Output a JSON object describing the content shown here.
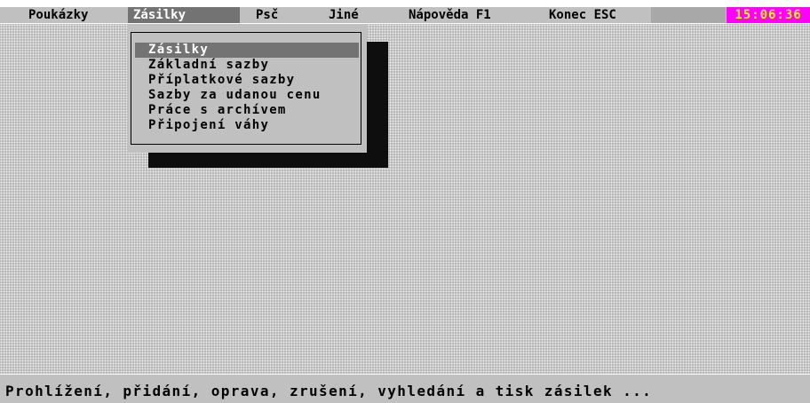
{
  "menubar": {
    "items": [
      {
        "label": "Poukázky"
      },
      {
        "label": "Zásilky"
      },
      {
        "label": "Psč"
      },
      {
        "label": "Jiné"
      },
      {
        "label": "Nápověda F1"
      },
      {
        "label": "Konec ESC"
      }
    ],
    "active_item": "Zásilky",
    "clock": "15:06:36"
  },
  "dropdown": {
    "selected_item": "Zásilky",
    "items": [
      {
        "label": "Zásilky"
      },
      {
        "label": "Základní sazby"
      },
      {
        "label": "Příplatkové sazby"
      },
      {
        "label": "Sazby za udanou cenu"
      },
      {
        "label": "Práce s archívem"
      },
      {
        "label": "Připojení váhy"
      }
    ]
  },
  "status": {
    "text": "Prohlížení, přidání, oprava, zrušení, vyhledání a tisk zásilek ..."
  },
  "colors": {
    "menu_bar": "#c0c0c0",
    "highlight": "#737373",
    "clock_bg": "#ff00ff",
    "clock_fg": "#ffff00"
  }
}
